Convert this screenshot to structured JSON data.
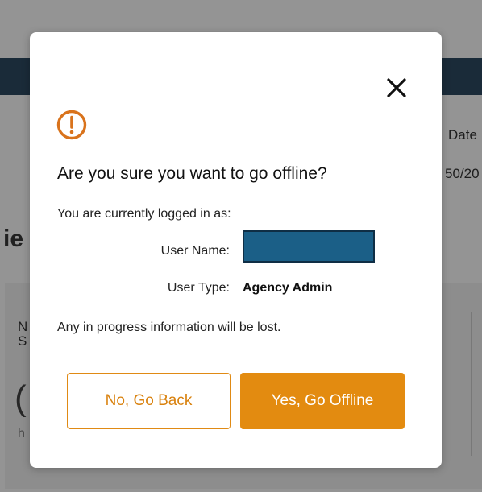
{
  "background": {
    "date_fragment": "Date",
    "year_fragment": "50/20",
    "title_fragment": "ie",
    "row_fragment_n": "N",
    "row_fragment_s": "S",
    "big_fragment": "(",
    "small_fragment": "h"
  },
  "modal": {
    "close_icon": "close-icon",
    "alert_icon": "alert-circle-icon",
    "title": "Are you sure you want to go offline?",
    "logged_in_text": "You are currently logged in as:",
    "username_label": "User Name:",
    "username_value": "",
    "usertype_label": "User Type:",
    "usertype_value": "Agency Admin",
    "warning_text": "Any in progress information will be lost.",
    "back_button_label": "No, Go Back",
    "offline_button_label": "Yes, Go Offline"
  },
  "colors": {
    "accent": "#e38b10",
    "header": "#2d4a63",
    "username_field": "#1b5f87"
  }
}
